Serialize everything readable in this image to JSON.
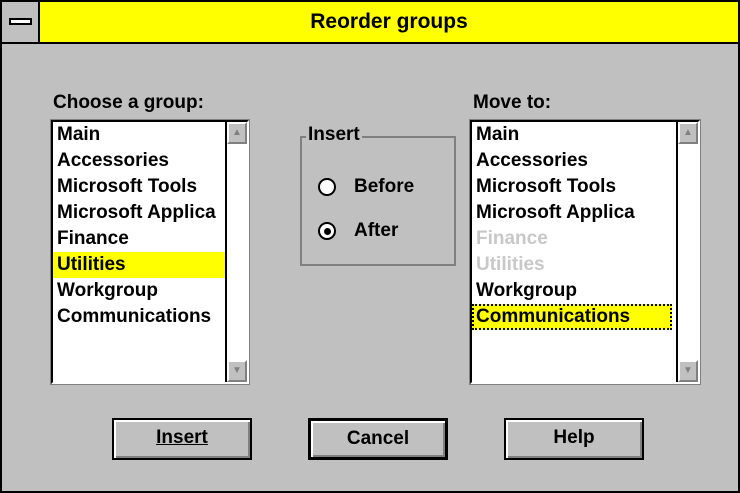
{
  "window": {
    "title": "Reorder groups"
  },
  "left": {
    "label": "Choose a group:",
    "items": [
      {
        "label": "Main",
        "state": "normal"
      },
      {
        "label": "Accessories",
        "state": "normal"
      },
      {
        "label": "Microsoft Tools",
        "state": "normal"
      },
      {
        "label": "Microsoft Applica",
        "state": "normal"
      },
      {
        "label": "Finance",
        "state": "normal"
      },
      {
        "label": "Utilities",
        "state": "selected"
      },
      {
        "label": "Workgroup",
        "state": "normal"
      },
      {
        "label": "Communications",
        "state": "normal"
      }
    ]
  },
  "insert_group": {
    "legend": "Insert",
    "before_label": "Before",
    "after_label": "After",
    "selected": "After"
  },
  "right": {
    "label": "Move to:",
    "items": [
      {
        "label": "Main",
        "state": "normal"
      },
      {
        "label": "Accessories",
        "state": "normal"
      },
      {
        "label": "Microsoft Tools",
        "state": "normal"
      },
      {
        "label": "Microsoft Applica",
        "state": "normal"
      },
      {
        "label": "Finance",
        "state": "disabled"
      },
      {
        "label": "Utilities",
        "state": "disabled"
      },
      {
        "label": "Workgroup",
        "state": "normal"
      },
      {
        "label": "Communications",
        "state": "focused"
      }
    ]
  },
  "buttons": {
    "insert_label": "Insert",
    "cancel_label": "Cancel",
    "help_label": "Help"
  },
  "colors": {
    "title_bar": "#ffff00",
    "selection": "#ffff00",
    "dialog_face": "#c0c0c0",
    "disabled_text": "#c8c8c8"
  }
}
